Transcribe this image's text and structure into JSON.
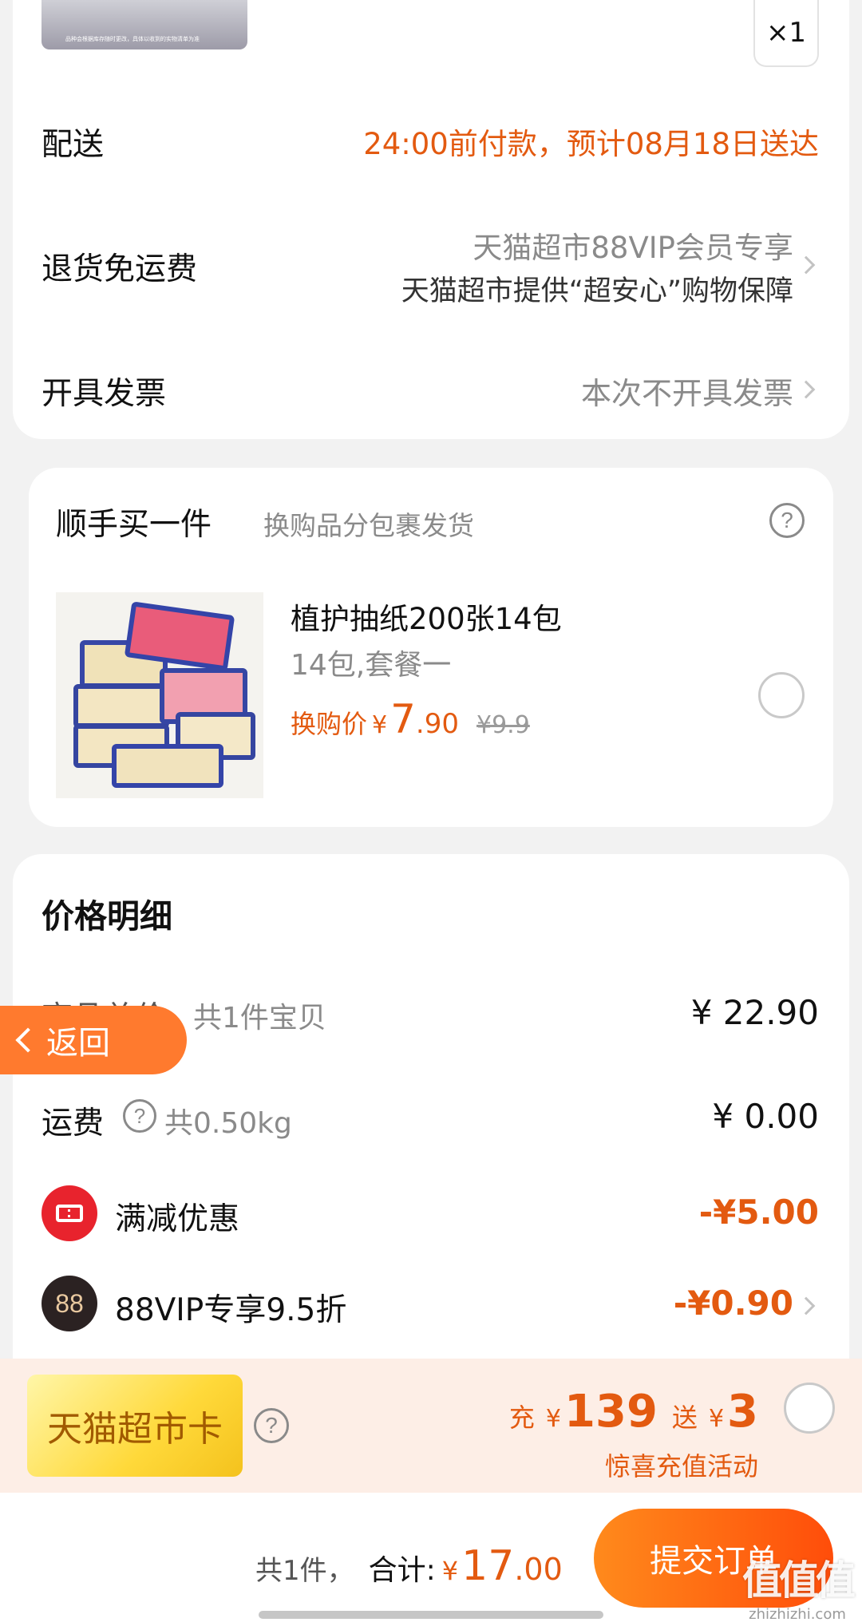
{
  "product_top": {
    "thumb_caption": "品种会根据库存随时更改，具体以收到的实物清单为准",
    "quantity": "×1"
  },
  "delivery": {
    "label": "配送",
    "value": "24:00前付款，预计08月18日送达"
  },
  "return_shipping": {
    "label": "退货免运费",
    "line1": "天猫超市88VIP会员专享",
    "line2": "天猫超市提供“超安心”购物保障"
  },
  "invoice": {
    "label": "开具发票",
    "value": "本次不开具发票"
  },
  "addon": {
    "title": "顺手买一件",
    "subtitle": "换购品分包裹发货",
    "help_icon": "?",
    "item": {
      "name": "植护抽纸200张14包",
      "spec": "14包,套餐一",
      "price_label": "换购价",
      "currency": "¥",
      "price_int": "7",
      "price_dec": ".90",
      "original_price": "¥9.9"
    }
  },
  "price_detail": {
    "title": "价格明细",
    "items_total_label": "商品总价",
    "items_total_sub": "共1件宝贝",
    "items_total_value": "¥ 22.90",
    "shipping_label": "运费",
    "shipping_sub": "共0.50kg",
    "shipping_value": "¥ 0.00",
    "discount_label": "满减优惠",
    "discount_value": "-¥5.00",
    "vip_badge": "88",
    "vip_label": "88VIP专享9.5折",
    "vip_value": "-¥0.90"
  },
  "back_button": {
    "label": "返回"
  },
  "promo": {
    "card_label": "天猫超市卡",
    "recharge_prefix": "充",
    "currency": "¥",
    "recharge_amount": "139",
    "gift_prefix": "送",
    "gift_amount": "3",
    "subtitle": "惊喜充值活动"
  },
  "footer": {
    "count": "共1件，",
    "total_label": "合计:",
    "currency": "¥",
    "total_int": "17",
    "total_dec": ".00",
    "submit_label": "提交订单"
  },
  "watermark": {
    "big": "值值值",
    "small": "zhizhizhi.com"
  },
  "colors": {
    "accent_orange": "#e35a10",
    "discount_badge": "#e8232d",
    "vip_badge": "#2b2222",
    "back_pill": "#ff7a2e"
  }
}
